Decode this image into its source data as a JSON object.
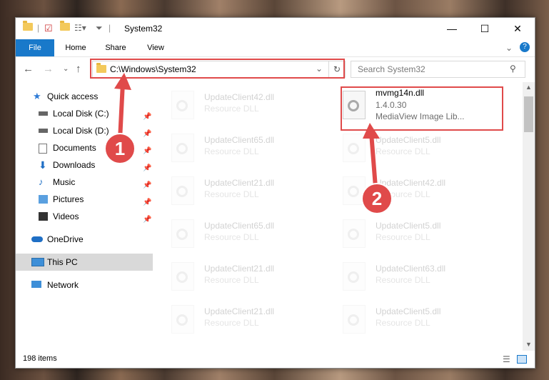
{
  "window": {
    "title": "System32"
  },
  "ribbon": {
    "tabs": [
      {
        "label": "File"
      },
      {
        "label": "Home"
      },
      {
        "label": "Share"
      },
      {
        "label": "View"
      }
    ]
  },
  "address": {
    "path": "C:\\Windows\\System32"
  },
  "search": {
    "placeholder": "Search System32"
  },
  "sidebar": {
    "items": [
      {
        "label": "Quick access",
        "icon": "star-icon"
      },
      {
        "label": "Local Disk (C:)",
        "icon": "drive-icon"
      },
      {
        "label": "Local Disk (D:)",
        "icon": "drive-icon"
      },
      {
        "label": "Documents",
        "icon": "documents-icon"
      },
      {
        "label": "Downloads",
        "icon": "download-icon"
      },
      {
        "label": "Music",
        "icon": "music-icon"
      },
      {
        "label": "Pictures",
        "icon": "pictures-icon"
      },
      {
        "label": "Videos",
        "icon": "videos-icon"
      },
      {
        "label": "OneDrive",
        "icon": "cloud-icon"
      },
      {
        "label": "This PC",
        "icon": "computer-icon"
      },
      {
        "label": "Network",
        "icon": "network-icon"
      }
    ]
  },
  "files": {
    "highlighted": {
      "name": "mvmg14n.dll",
      "version": "1.4.0.30",
      "description": "MediaView Image Lib..."
    },
    "left": [
      {
        "name": "UpdateClient42.dll",
        "type": "Resource DLL"
      },
      {
        "name": "UpdateClient65.dll",
        "type": "Resource DLL"
      },
      {
        "name": "UpdateClient21.dll",
        "type": "Resource DLL"
      },
      {
        "name": "UpdateClient65.dll",
        "type": "Resource DLL"
      },
      {
        "name": "UpdateClient21.dll",
        "type": "Resource DLL"
      },
      {
        "name": "UpdateClient21.dll",
        "type": "Resource DLL"
      }
    ],
    "right": [
      {
        "name": "UpdateClient5.dll",
        "type": "Resource DLL"
      },
      {
        "name": "UpdateClient42.dll",
        "type": "Resource DLL"
      },
      {
        "name": "UpdateClient5.dll",
        "type": "Resource DLL"
      },
      {
        "name": "UpdateClient63.dll",
        "type": "Resource DLL"
      },
      {
        "name": "UpdateClient5.dll",
        "type": "Resource DLL"
      }
    ]
  },
  "status": {
    "items": "198 items"
  },
  "annotations": {
    "badge1": "1",
    "badge2": "2"
  },
  "colors": {
    "highlight": "#e04a4a",
    "accent": "#1979ca"
  }
}
